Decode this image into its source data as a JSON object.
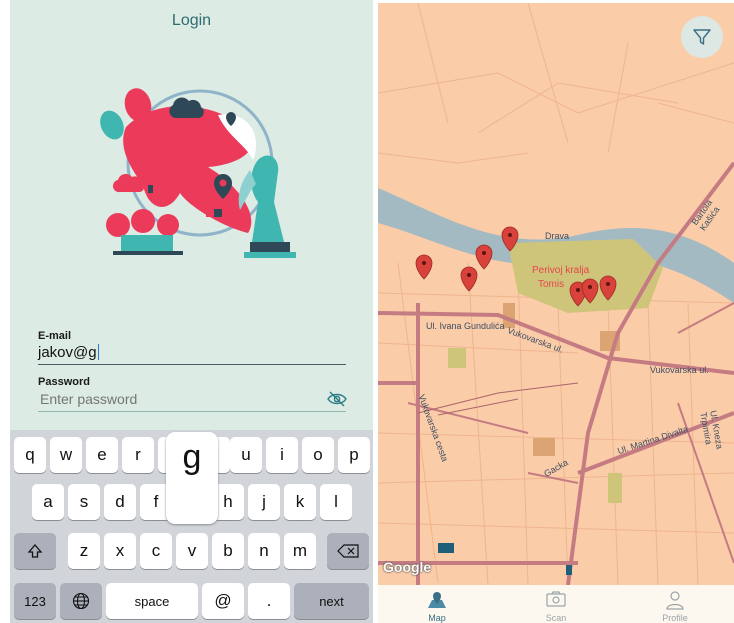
{
  "login": {
    "title": "Login",
    "email_label": "E-mail",
    "email_value": "jakov@g",
    "password_label": "Password",
    "password_placeholder": "Enter password"
  },
  "keyboard": {
    "row1": [
      "q",
      "w",
      "e",
      "r",
      "g",
      "u",
      "i",
      "o",
      "p"
    ],
    "row2": [
      "a",
      "s",
      "d",
      "f",
      "h",
      "j",
      "k",
      "l"
    ],
    "row3": [
      "z",
      "x",
      "c",
      "v",
      "b",
      "n",
      "m"
    ],
    "popup_letter": "g",
    "numbers_key": "123",
    "space_key": "space",
    "at_key": "@",
    "period_key": ".",
    "next_key": "next"
  },
  "map": {
    "labels": {
      "river": "Drava",
      "park": [
        "Perivoj kralja",
        "Tomis"
      ],
      "street1": "Ul. Ivana Gundulića",
      "street2": "Vukovarska ul.",
      "street3": "Vukovarska ul.",
      "street4": "Ul. Martina Divalta",
      "street5": "Gacka",
      "street6": "Vukovarska cesta",
      "street7": "Ul. Kneza Trpimira",
      "street8": "Bartola Kašića"
    },
    "attribution": "Google",
    "marker_color": "#d9413b"
  },
  "tabbar": {
    "tabs": [
      {
        "label": "Map",
        "icon": "map-icon",
        "active": true
      },
      {
        "label": "Scan",
        "icon": "camera-icon",
        "active": false
      },
      {
        "label": "Profile",
        "icon": "profile-icon",
        "active": false
      }
    ]
  }
}
